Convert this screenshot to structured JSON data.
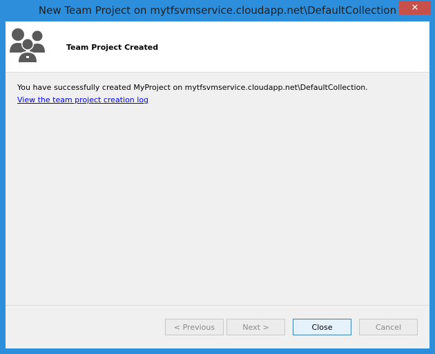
{
  "window": {
    "title": "New Team Project on mytfsvmservice.cloudapp.net\\DefaultCollection",
    "close_glyph": "✕"
  },
  "header": {
    "title": "Team Project Created",
    "icon": "team-people-icon"
  },
  "body": {
    "message": "You have successfully created MyProject on mytfsvmservice.cloudapp.net\\DefaultCollection.",
    "link": "View the team project creation log"
  },
  "buttons": {
    "previous": "< Previous",
    "next": "Next >",
    "close": "Close",
    "cancel": "Cancel"
  },
  "colors": {
    "titlebar": "#2d8fdb",
    "close_button": "#c7504a",
    "link": "#0000ee"
  }
}
